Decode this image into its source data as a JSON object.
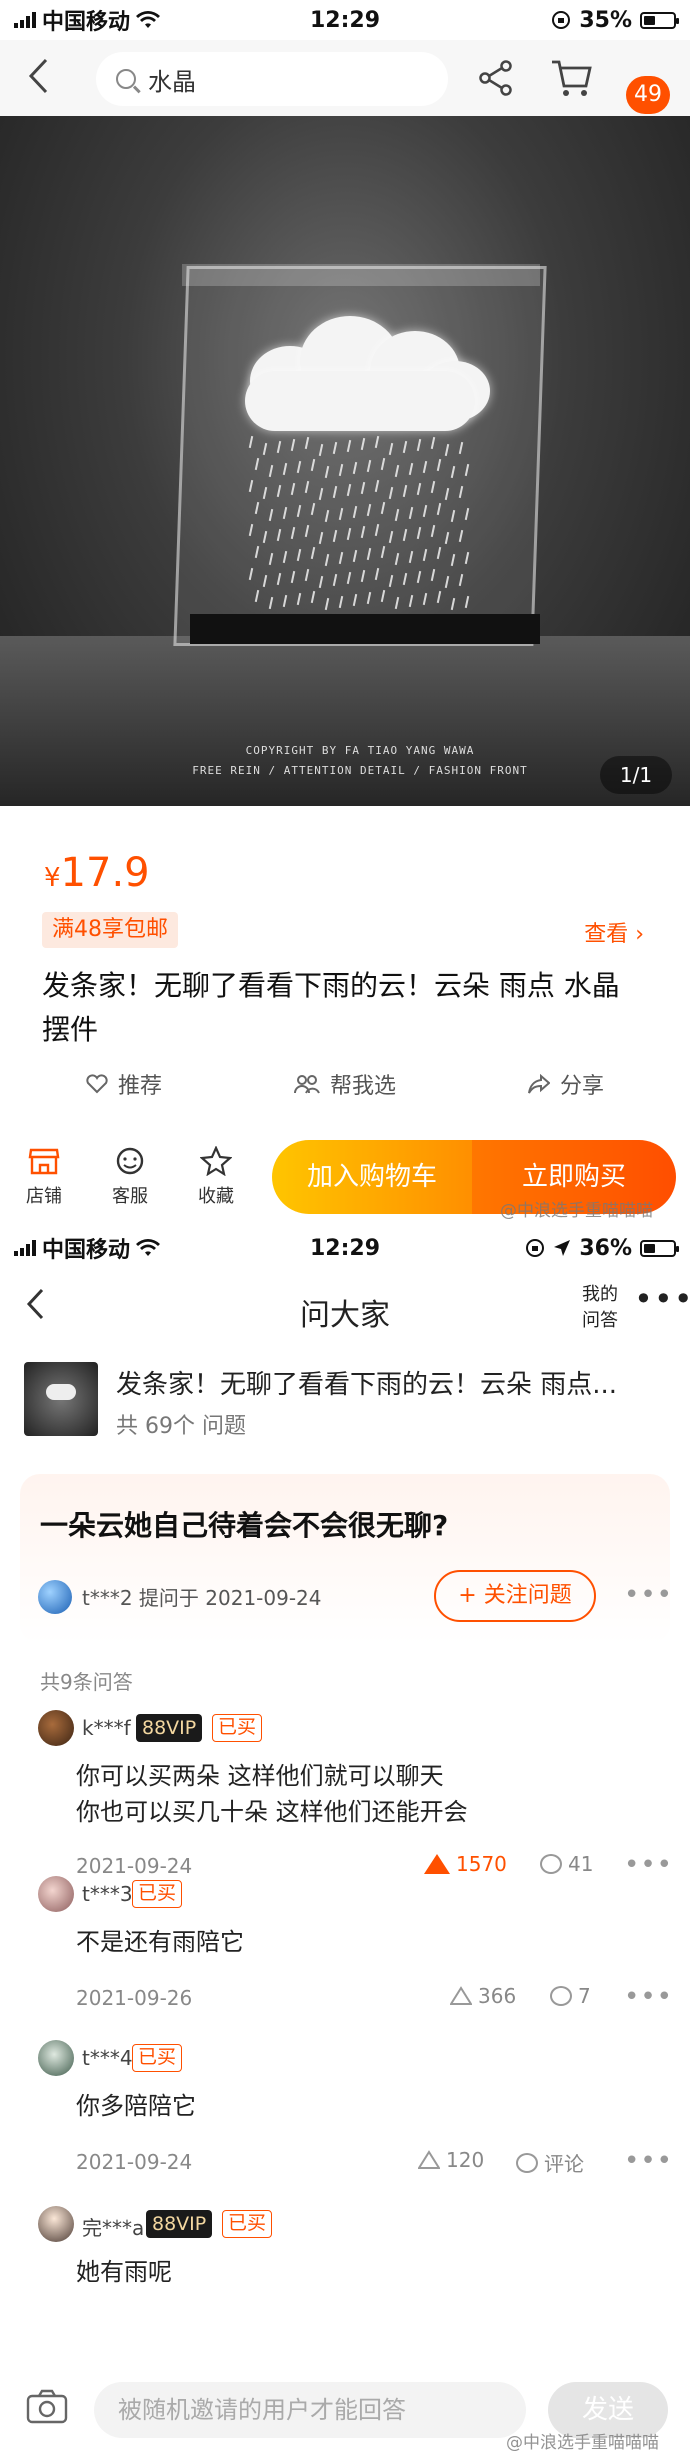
{
  "screen1": {
    "status": {
      "carrier": "中国移动",
      "time": "12:29",
      "battery": "35%",
      "battery_level": 0.35
    },
    "search": {
      "query": "水晶"
    },
    "cart_badge": "49",
    "image": {
      "copyright_line1": "COPYRIGHT BY FA TIAO YANG WAWA",
      "copyright_line2": "FREE REIN / ATTENTION DETAIL / FASHION FRONT",
      "counter": "1/1"
    },
    "product": {
      "currency": "¥",
      "price": "17.9",
      "promo": "满48享包邮",
      "view_label": "查看 ›",
      "title": "发条家！无聊了看看下雨的云！云朵 雨点 水晶 摆件"
    },
    "actions": {
      "recommend": "推荐",
      "help_pick": "帮我选",
      "share": "分享"
    },
    "toolbar": {
      "shop": "店铺",
      "service": "客服",
      "favorite": "收藏",
      "add_cart": "加入购物车",
      "buy_now": "立即购买"
    },
    "watermark": "@中浪选手重喵喵喵"
  },
  "screen2": {
    "status": {
      "carrier": "中国移动",
      "time": "12:29",
      "battery": "36%",
      "battery_level": 0.36
    },
    "header": {
      "title": "问大家",
      "my_qa_line1": "我的",
      "my_qa_line2": "问答",
      "more": "•••"
    },
    "product": {
      "title": "发条家！无聊了看看下雨的云！云朵 雨点...",
      "count": "共 69个 问题"
    },
    "question": {
      "text": "一朵云她自己待着会不会很无聊?",
      "asker": "t***2 提问于 2021-09-24",
      "follow": "+ 关注问题"
    },
    "answers_count": "共9条问答",
    "answers": [
      {
        "name": "k***f",
        "vip": "88VIP",
        "bought": "已买",
        "line1": "你可以买两朵 这样他们就可以聊天",
        "line2": "你也可以买几十朵 这样他们还能开会",
        "date": "2021-09-24",
        "likes": "1570",
        "comments": "41"
      },
      {
        "name": "t***3",
        "bought": "已买",
        "line1": "不是还有雨陪它",
        "date": "2021-09-26",
        "likes": "366",
        "comments": "7"
      },
      {
        "name": "t***4",
        "bought": "已买",
        "line1": "你多陪陪它",
        "date": "2021-09-24",
        "likes": "120",
        "comments": "评论"
      },
      {
        "name": "完***a",
        "vip": "88VIP",
        "bought": "已买",
        "line1": "她有雨呢"
      }
    ],
    "input": {
      "placeholder": "被随机邀请的用户才能回答",
      "send": "发送"
    },
    "watermark": "@中浪选手重喵喵喵"
  },
  "colors": {
    "accent": "#ff5000",
    "buy_gradient_start": "#ff7700",
    "cart_gradient_start": "#ffc500"
  }
}
